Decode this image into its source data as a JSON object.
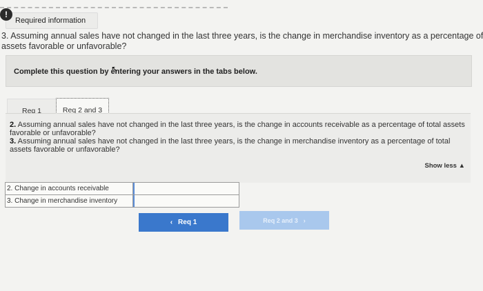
{
  "header": {
    "alert_icon": "!",
    "required_info": "Required information"
  },
  "question": {
    "text": "3. Assuming annual sales have not changed in the last three years, is the change in merchandise inventory as a percentage of\nassets favorable or unfavorable?"
  },
  "instructions": {
    "text": "Complete this question by entering your answers in the tabs below."
  },
  "tabs": [
    {
      "label": "Req 1"
    },
    {
      "label": "Req 2 and 3"
    }
  ],
  "content": {
    "q2_num": "2.",
    "q2_text": " Assuming annual sales have not changed in the last three years, is the change in accounts receivable as a percentage of total assets favorable or unfavorable?",
    "q3_num": "3.",
    "q3_text": " Assuming annual sales have not changed in the last three years, is the change in merchandise inventory as a percentage of total assets favorable or unfavorable?",
    "show_less": "Show less ▲"
  },
  "answers": [
    {
      "label": "2. Change in accounts receivable",
      "value": ""
    },
    {
      "label": "3. Change in merchandise inventory",
      "value": ""
    }
  ],
  "nav": {
    "prev_label": "Req 1",
    "next_label": "Req 2 and 3"
  },
  "colors": {
    "primary": "#3a78cc",
    "disabled": "#a9c8ed"
  }
}
